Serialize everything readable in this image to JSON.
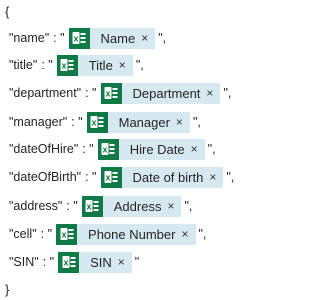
{
  "open_brace": "{",
  "close_brace": "}",
  "colon_quote": ": \"",
  "fields": [
    {
      "key": "\"name\"",
      "token": "Name",
      "suffix": "\","
    },
    {
      "key": "\"title\"",
      "token": "Title",
      "suffix": "\","
    },
    {
      "key": "\"department\"",
      "token": "Department",
      "suffix": "\","
    },
    {
      "key": "\"manager\"",
      "token": "Manager",
      "suffix": "\","
    },
    {
      "key": "\"dateOfHire\"",
      "token": "Hire Date",
      "suffix": "\","
    },
    {
      "key": "\"dateOfBirth\"",
      "token": "Date of birth",
      "suffix": "\","
    },
    {
      "key": "\"address\"",
      "token": "Address",
      "suffix": "\","
    },
    {
      "key": "\"cell\"",
      "token": "Phone Number",
      "suffix": "\","
    },
    {
      "key": "\"SIN\"",
      "token": "SIN",
      "suffix": "\""
    }
  ],
  "token_remove_glyph": "×",
  "token_icon": "excel-icon",
  "colors": {
    "token_bg": "#d6e9f0",
    "icon_bg": "#0f7a45",
    "text": "#252525"
  }
}
